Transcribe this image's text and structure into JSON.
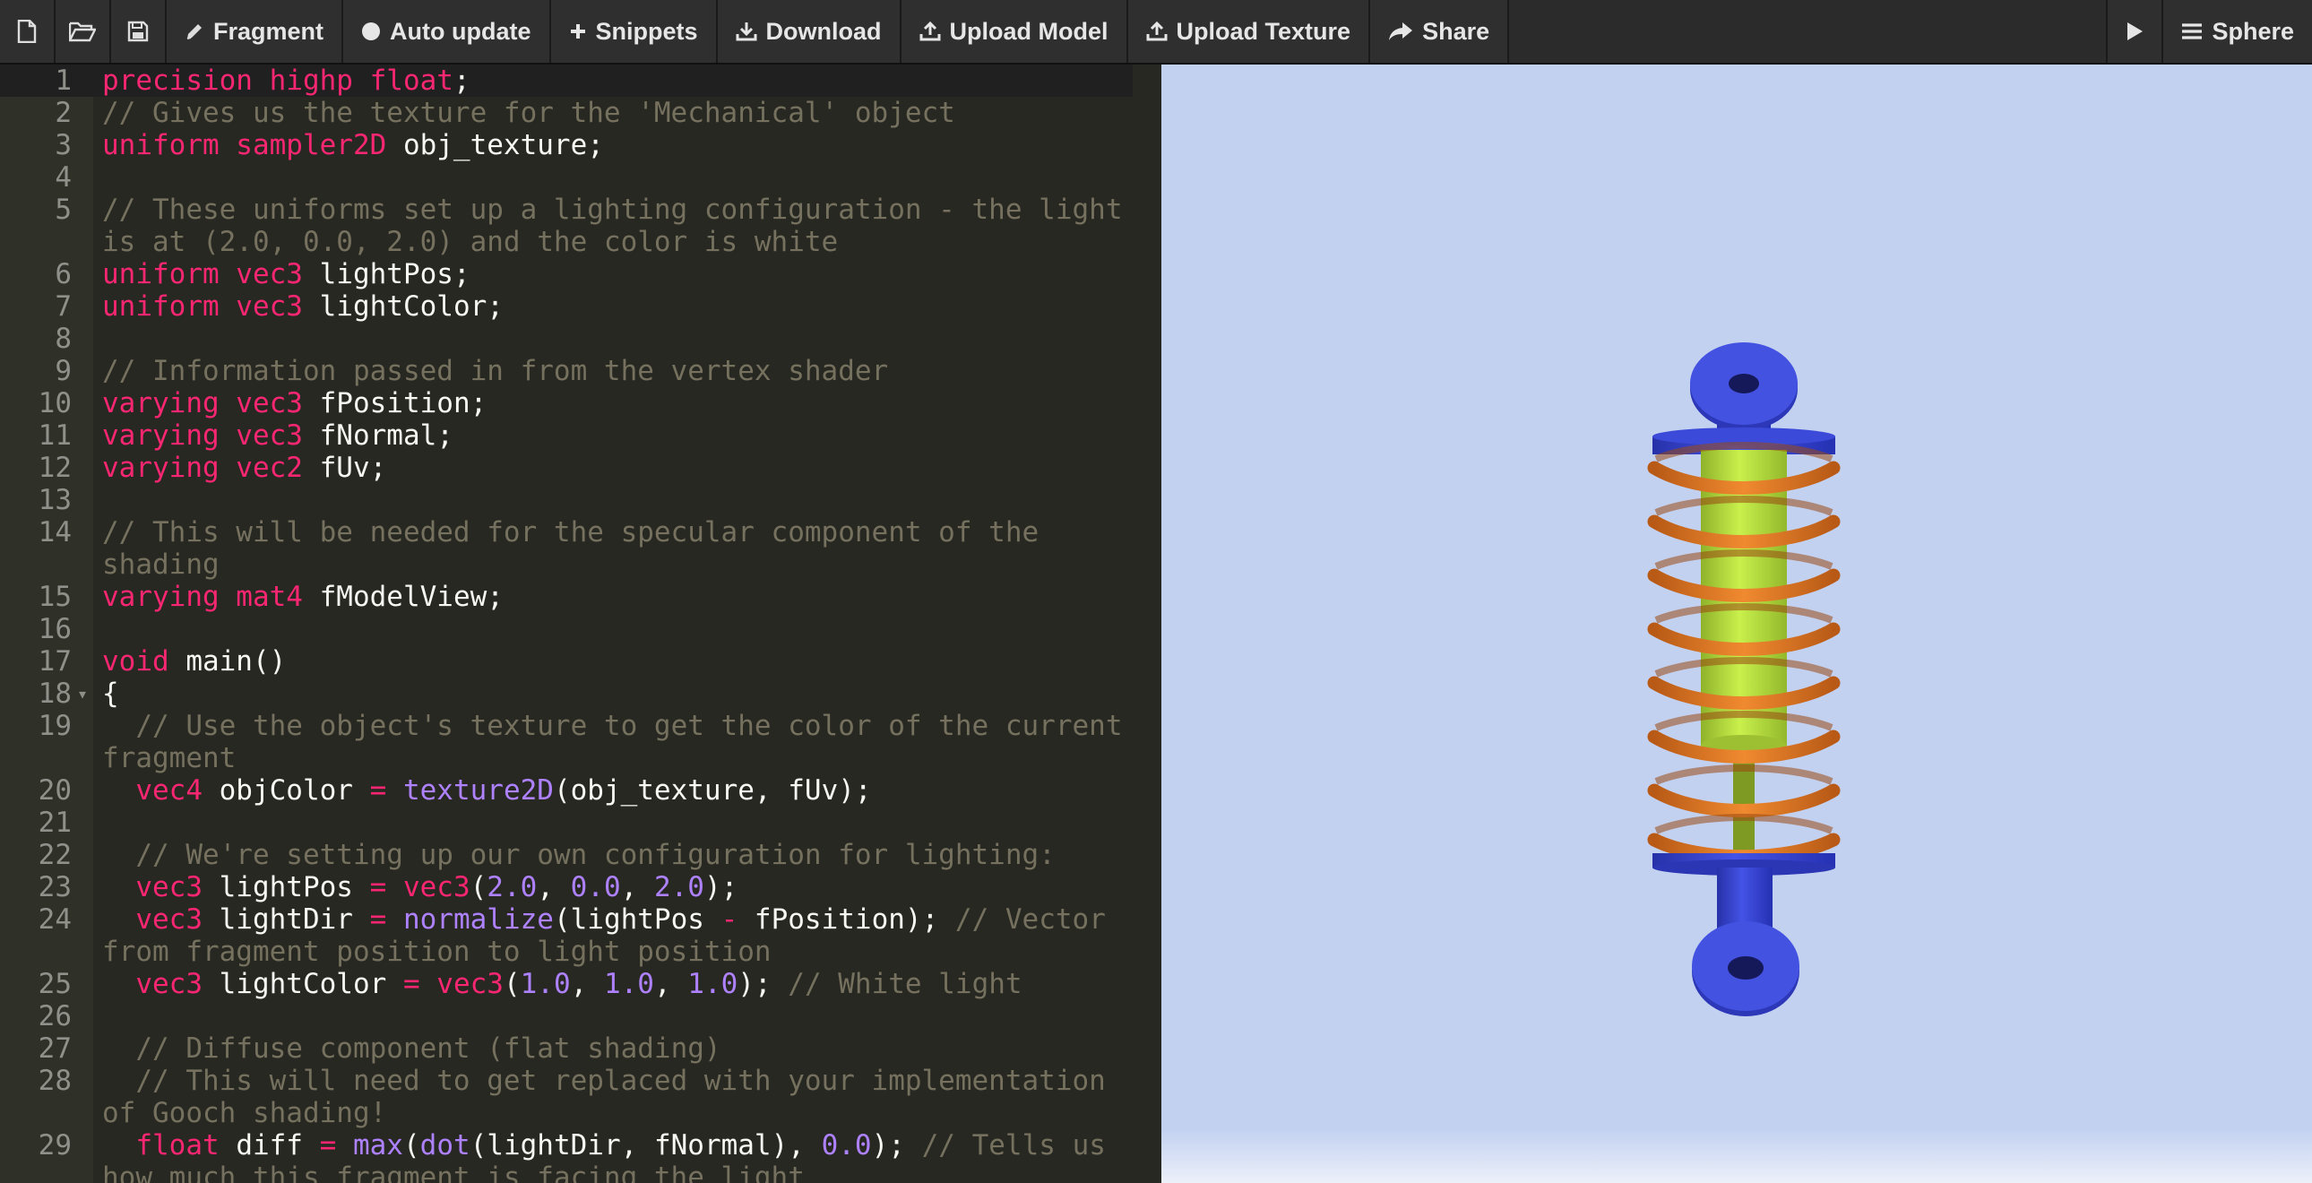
{
  "toolbar": {
    "left": [
      {
        "name": "new-file-button",
        "icon": "file-icon",
        "label": ""
      },
      {
        "name": "open-file-button",
        "icon": "folder-open-icon",
        "label": ""
      },
      {
        "name": "save-button",
        "icon": "floppy-disk-icon",
        "label": ""
      },
      {
        "name": "fragment-button",
        "icon": "pencil-icon",
        "label": "Fragment"
      },
      {
        "name": "auto-update-button",
        "icon": "circle-icon",
        "label": "Auto update"
      },
      {
        "name": "snippets-button",
        "icon": "plus-icon",
        "label": "Snippets"
      },
      {
        "name": "download-button",
        "icon": "download-icon",
        "label": "Download"
      },
      {
        "name": "upload-model-button",
        "icon": "upload-icon",
        "label": "Upload Model"
      },
      {
        "name": "upload-texture-button",
        "icon": "upload-icon",
        "label": "Upload Texture"
      },
      {
        "name": "share-button",
        "icon": "share-arrow-icon",
        "label": "Share"
      }
    ],
    "right": [
      {
        "name": "run-button",
        "icon": "play-icon",
        "label": ""
      },
      {
        "name": "model-menu-button",
        "icon": "hamburger-menu-icon",
        "label": "Sphere"
      }
    ]
  },
  "editor": {
    "active_line": "1",
    "lines": [
      {
        "n": "1",
        "tokens": [
          [
            "kw",
            "precision highp float"
          ],
          [
            "pl",
            ";"
          ]
        ]
      },
      {
        "n": "2",
        "tokens": [
          [
            "cm",
            "// Gives us the texture for the 'Mechanical' object"
          ]
        ]
      },
      {
        "n": "3",
        "tokens": [
          [
            "kw",
            "uniform sampler2D"
          ],
          [
            "pl",
            " obj_texture;"
          ]
        ]
      },
      {
        "n": "4",
        "tokens": []
      },
      {
        "n": "5",
        "tokens": [
          [
            "cm",
            "// These uniforms set up a lighting configuration - the light is at (2.0, 0.0, 2.0) and the color is white"
          ]
        ]
      },
      {
        "n": "6",
        "tokens": [
          [
            "kw",
            "uniform vec3"
          ],
          [
            "pl",
            " lightPos;"
          ]
        ]
      },
      {
        "n": "7",
        "tokens": [
          [
            "kw",
            "uniform vec3"
          ],
          [
            "pl",
            " lightColor;"
          ]
        ]
      },
      {
        "n": "8",
        "tokens": []
      },
      {
        "n": "9",
        "tokens": [
          [
            "cm",
            "// Information passed in from the vertex shader"
          ]
        ]
      },
      {
        "n": "10",
        "tokens": [
          [
            "kw",
            "varying vec3"
          ],
          [
            "pl",
            " fPosition;"
          ]
        ]
      },
      {
        "n": "11",
        "tokens": [
          [
            "kw",
            "varying vec3"
          ],
          [
            "pl",
            " fNormal;"
          ]
        ]
      },
      {
        "n": "12",
        "tokens": [
          [
            "kw",
            "varying vec2"
          ],
          [
            "pl",
            " fUv;"
          ]
        ]
      },
      {
        "n": "13",
        "tokens": []
      },
      {
        "n": "14",
        "tokens": [
          [
            "cm",
            "// This will be needed for the specular component of the shading"
          ]
        ]
      },
      {
        "n": "15",
        "tokens": [
          [
            "kw",
            "varying mat4"
          ],
          [
            "pl",
            " fModelView;"
          ]
        ]
      },
      {
        "n": "16",
        "tokens": []
      },
      {
        "n": "17",
        "tokens": [
          [
            "kw",
            "void"
          ],
          [
            "pl",
            " main()"
          ]
        ]
      },
      {
        "n": "18",
        "fold": true,
        "tokens": [
          [
            "pl",
            "{"
          ]
        ]
      },
      {
        "n": "19",
        "tokens": [
          [
            "pl",
            "  "
          ],
          [
            "cm",
            "// Use the object's texture to get the color of the current fragment"
          ]
        ]
      },
      {
        "n": "20",
        "tokens": [
          [
            "pl",
            "  "
          ],
          [
            "kw",
            "vec4"
          ],
          [
            "pl",
            " objColor "
          ],
          [
            "op",
            "="
          ],
          [
            "pl",
            " "
          ],
          [
            "fn",
            "texture2D"
          ],
          [
            "pl",
            "(obj_texture, fUv);"
          ]
        ]
      },
      {
        "n": "21",
        "tokens": []
      },
      {
        "n": "22",
        "tokens": [
          [
            "pl",
            "  "
          ],
          [
            "cm",
            "// We're setting up our own configuration for lighting:"
          ]
        ]
      },
      {
        "n": "23",
        "tokens": [
          [
            "pl",
            "  "
          ],
          [
            "kw",
            "vec3"
          ],
          [
            "pl",
            " lightPos "
          ],
          [
            "op",
            "="
          ],
          [
            "pl",
            " "
          ],
          [
            "kw",
            "vec3"
          ],
          [
            "pl",
            "("
          ],
          [
            "num",
            "2.0"
          ],
          [
            "pl",
            ", "
          ],
          [
            "num",
            "0.0"
          ],
          [
            "pl",
            ", "
          ],
          [
            "num",
            "2.0"
          ],
          [
            "pl",
            ");"
          ]
        ]
      },
      {
        "n": "24",
        "tokens": [
          [
            "pl",
            "  "
          ],
          [
            "kw",
            "vec3"
          ],
          [
            "pl",
            " lightDir "
          ],
          [
            "op",
            "="
          ],
          [
            "pl",
            " "
          ],
          [
            "fn",
            "normalize"
          ],
          [
            "pl",
            "(lightPos "
          ],
          [
            "op",
            "-"
          ],
          [
            "pl",
            " fPosition); "
          ],
          [
            "cm",
            "// Vector from fragment position to light position"
          ]
        ]
      },
      {
        "n": "25",
        "tokens": [
          [
            "pl",
            "  "
          ],
          [
            "kw",
            "vec3"
          ],
          [
            "pl",
            " lightColor "
          ],
          [
            "op",
            "="
          ],
          [
            "pl",
            " "
          ],
          [
            "kw",
            "vec3"
          ],
          [
            "pl",
            "("
          ],
          [
            "num",
            "1.0"
          ],
          [
            "pl",
            ", "
          ],
          [
            "num",
            "1.0"
          ],
          [
            "pl",
            ", "
          ],
          [
            "num",
            "1.0"
          ],
          [
            "pl",
            "); "
          ],
          [
            "cm",
            "// White light"
          ]
        ]
      },
      {
        "n": "26",
        "tokens": []
      },
      {
        "n": "27",
        "tokens": [
          [
            "pl",
            "  "
          ],
          [
            "cm",
            "// Diffuse component (flat shading)"
          ]
        ]
      },
      {
        "n": "28",
        "tokens": [
          [
            "pl",
            "  "
          ],
          [
            "cm",
            "// This will need to get replaced with your implementation of Gooch shading!"
          ]
        ]
      },
      {
        "n": "29",
        "tokens": [
          [
            "pl",
            "  "
          ],
          [
            "kw",
            "float"
          ],
          [
            "pl",
            " diff "
          ],
          [
            "op",
            "="
          ],
          [
            "pl",
            " "
          ],
          [
            "fn",
            "max"
          ],
          [
            "pl",
            "("
          ],
          [
            "fn",
            "dot"
          ],
          [
            "pl",
            "(lightDir, fNormal), "
          ],
          [
            "num",
            "0.0"
          ],
          [
            "pl",
            "); "
          ],
          [
            "cm",
            "// Tells us how much this fragment is facing the light"
          ]
        ]
      }
    ]
  },
  "colors": {
    "editor_bg": "#272822",
    "keyword": "#f92672",
    "comment": "#75715e",
    "function": "#ae81ff",
    "number": "#ae81ff",
    "text": "#f8f8f2",
    "viewport_bg": "#c3d1f1",
    "model_blue": "#3a48d6",
    "spring_orange": "#e47a26",
    "cylinder_green": "#b4e03c"
  }
}
